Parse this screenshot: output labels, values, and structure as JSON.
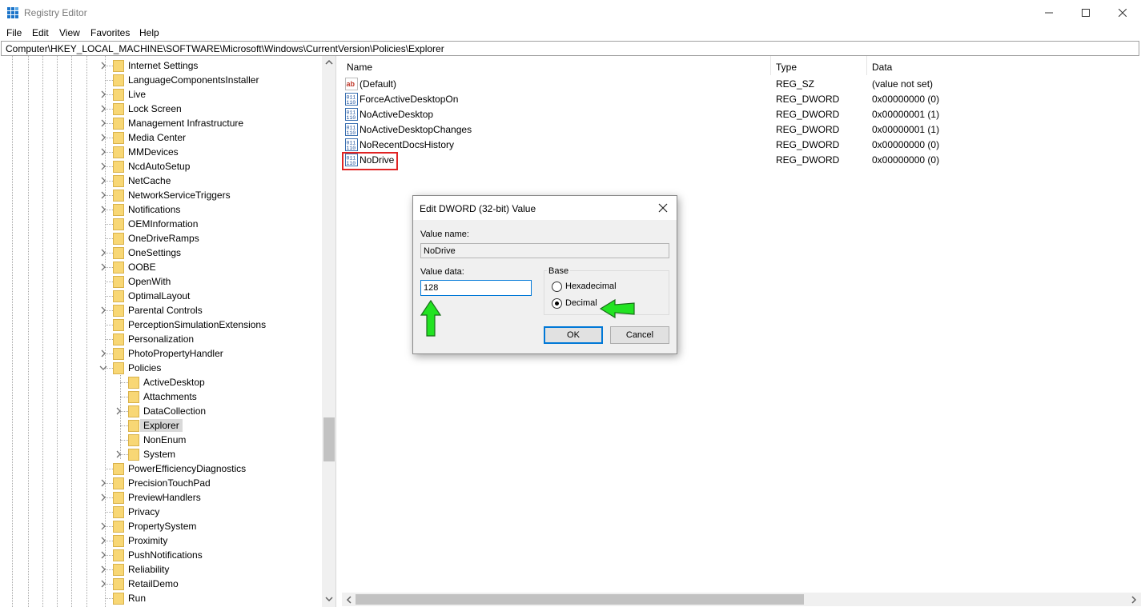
{
  "window": {
    "title": "Registry Editor"
  },
  "menu": [
    "File",
    "Edit",
    "View",
    "Favorites",
    "Help"
  ],
  "address": "Computer\\HKEY_LOCAL_MACHINE\\SOFTWARE\\Microsoft\\Windows\\CurrentVersion\\Policies\\Explorer",
  "tree": {
    "items": [
      {
        "label": "Internet Settings",
        "level": 0,
        "expander": "collapsed"
      },
      {
        "label": "LanguageComponentsInstaller",
        "level": 0,
        "expander": "none"
      },
      {
        "label": "Live",
        "level": 0,
        "expander": "collapsed"
      },
      {
        "label": "Lock Screen",
        "level": 0,
        "expander": "collapsed"
      },
      {
        "label": "Management Infrastructure",
        "level": 0,
        "expander": "collapsed"
      },
      {
        "label": "Media Center",
        "level": 0,
        "expander": "collapsed"
      },
      {
        "label": "MMDevices",
        "level": 0,
        "expander": "collapsed"
      },
      {
        "label": "NcdAutoSetup",
        "level": 0,
        "expander": "collapsed"
      },
      {
        "label": "NetCache",
        "level": 0,
        "expander": "collapsed"
      },
      {
        "label": "NetworkServiceTriggers",
        "level": 0,
        "expander": "collapsed"
      },
      {
        "label": "Notifications",
        "level": 0,
        "expander": "collapsed"
      },
      {
        "label": "OEMInformation",
        "level": 0,
        "expander": "none"
      },
      {
        "label": "OneDriveRamps",
        "level": 0,
        "expander": "none"
      },
      {
        "label": "OneSettings",
        "level": 0,
        "expander": "collapsed"
      },
      {
        "label": "OOBE",
        "level": 0,
        "expander": "collapsed"
      },
      {
        "label": "OpenWith",
        "level": 0,
        "expander": "none"
      },
      {
        "label": "OptimalLayout",
        "level": 0,
        "expander": "none"
      },
      {
        "label": "Parental Controls",
        "level": 0,
        "expander": "collapsed"
      },
      {
        "label": "PerceptionSimulationExtensions",
        "level": 0,
        "expander": "none"
      },
      {
        "label": "Personalization",
        "level": 0,
        "expander": "none"
      },
      {
        "label": "PhotoPropertyHandler",
        "level": 0,
        "expander": "collapsed"
      },
      {
        "label": "Policies",
        "level": 0,
        "expander": "expanded"
      },
      {
        "label": "ActiveDesktop",
        "level": 1,
        "expander": "none"
      },
      {
        "label": "Attachments",
        "level": 1,
        "expander": "none"
      },
      {
        "label": "DataCollection",
        "level": 1,
        "expander": "collapsed"
      },
      {
        "label": "Explorer",
        "level": 1,
        "expander": "none",
        "selected": true
      },
      {
        "label": "NonEnum",
        "level": 1,
        "expander": "none"
      },
      {
        "label": "System",
        "level": 1,
        "expander": "collapsed"
      },
      {
        "label": "PowerEfficiencyDiagnostics",
        "level": 0,
        "expander": "none"
      },
      {
        "label": "PrecisionTouchPad",
        "level": 0,
        "expander": "collapsed"
      },
      {
        "label": "PreviewHandlers",
        "level": 0,
        "expander": "collapsed"
      },
      {
        "label": "Privacy",
        "level": 0,
        "expander": "none"
      },
      {
        "label": "PropertySystem",
        "level": 0,
        "expander": "collapsed"
      },
      {
        "label": "Proximity",
        "level": 0,
        "expander": "collapsed"
      },
      {
        "label": "PushNotifications",
        "level": 0,
        "expander": "collapsed"
      },
      {
        "label": "Reliability",
        "level": 0,
        "expander": "collapsed"
      },
      {
        "label": "RetailDemo",
        "level": 0,
        "expander": "collapsed"
      },
      {
        "label": "Run",
        "level": 0,
        "expander": "none"
      }
    ]
  },
  "list": {
    "columns": [
      "Name",
      "Type",
      "Data"
    ],
    "rows": [
      {
        "name": "(Default)",
        "type": "REG_SZ",
        "data": "(value not set)",
        "icon": "string-value-icon"
      },
      {
        "name": "ForceActiveDesktopOn",
        "type": "REG_DWORD",
        "data": "0x00000000 (0)",
        "icon": "binary-value-icon"
      },
      {
        "name": "NoActiveDesktop",
        "type": "REG_DWORD",
        "data": "0x00000001 (1)",
        "icon": "binary-value-icon"
      },
      {
        "name": "NoActiveDesktopChanges",
        "type": "REG_DWORD",
        "data": "0x00000001 (1)",
        "icon": "binary-value-icon"
      },
      {
        "name": "NoRecentDocsHistory",
        "type": "REG_DWORD",
        "data": "0x00000000 (0)",
        "icon": "binary-value-icon"
      },
      {
        "name": "NoDrive",
        "type": "REG_DWORD",
        "data": "0x00000000 (0)",
        "icon": "binary-value-icon",
        "highlighted": true
      }
    ]
  },
  "dialog": {
    "title": "Edit DWORD (32-bit) Value",
    "value_name_label": "Value name:",
    "value_name": "NoDrive",
    "value_data_label": "Value data:",
    "value_data": "128",
    "base_label": "Base",
    "base_options": [
      {
        "label": "Hexadecimal",
        "selected": false
      },
      {
        "label": "Decimal",
        "selected": true
      }
    ],
    "ok_label": "OK",
    "cancel_label": "Cancel"
  },
  "colors": {
    "accent": "#0078d7",
    "highlight_box": "#e02424",
    "arrow": "#22e322",
    "folder": "#f8d775"
  }
}
